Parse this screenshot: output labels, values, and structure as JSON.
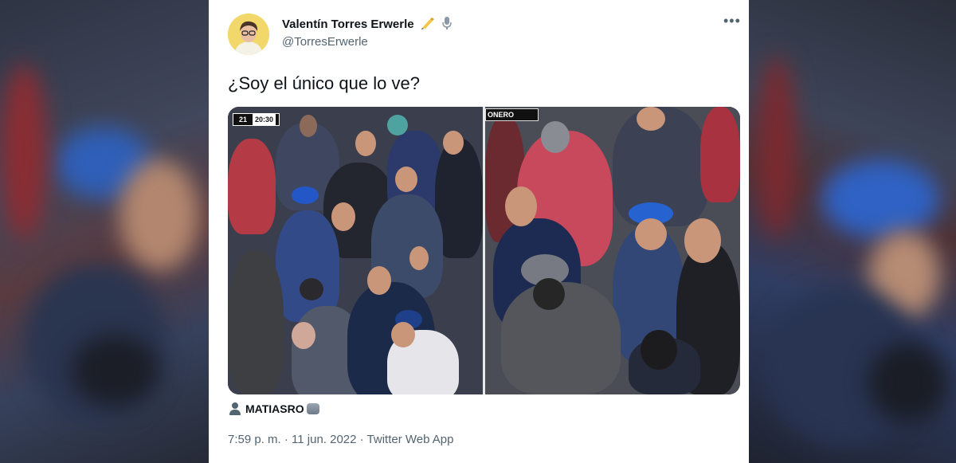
{
  "tweet": {
    "display_name": "Valentín Torres Erwerle",
    "name_emoji": [
      "writing-hand-icon",
      "microphone-icon"
    ],
    "handle": "@TorresErwerle",
    "more_label": "•••",
    "text": "¿Soy el único que lo ve?",
    "media": {
      "left": {
        "scoreboard_team": "21",
        "scoreboard_clock": "20:30"
      },
      "right": {
        "chyron": "ONERO"
      }
    },
    "media_credit": "MATIASRO",
    "timestamp": "7:59 p. m. · 11 jun. 2022 · Twitter Web App"
  }
}
